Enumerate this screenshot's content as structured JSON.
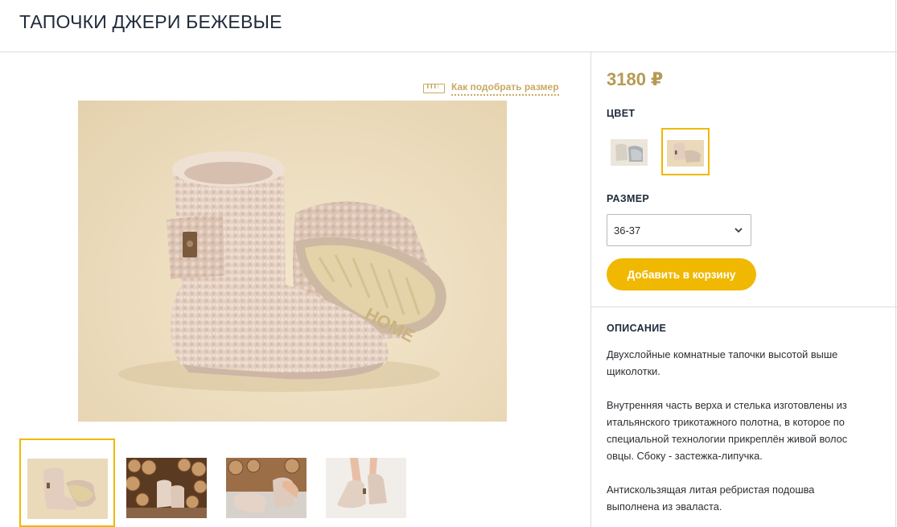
{
  "product": {
    "title": "ТАПОЧКИ ДЖЕРИ БЕЖЕВЫЕ",
    "price": "3180 ₽",
    "size_guide": "Как подобрать размер",
    "color_label": "ЦВЕТ",
    "size_label": "РАЗМЕР",
    "selected_size": "36-37",
    "add_to_cart": "Добавить в корзину",
    "description_label": "ОПИСАНИЕ",
    "description": [
      "Двухслойные комнатные тапочки высотой выше щиколотки.",
      "Внутренняя часть верха и стелька изготовлены из итальянского трикотажного полотна, в которое по специальной технологии прикреплён живой волос овцы. Сбоку - застежка-липучка.",
      "Антискользящая литая ребристая подошва выполнена из эваласта."
    ]
  },
  "colors": [
    {
      "name": "grey",
      "selected": false,
      "hex": "#b8bcc0"
    },
    {
      "name": "beige",
      "selected": true,
      "hex": "#e6d2c4"
    }
  ],
  "theme": {
    "accent": "#f0b800",
    "gold": "#c9a961",
    "price": "#b59a54"
  },
  "thumbnails": [
    {
      "name": "thumb-studio-pair",
      "active": true
    },
    {
      "name": "thumb-woodpile",
      "active": false
    },
    {
      "name": "thumb-hands",
      "active": false
    },
    {
      "name": "thumb-worn",
      "active": false
    }
  ]
}
